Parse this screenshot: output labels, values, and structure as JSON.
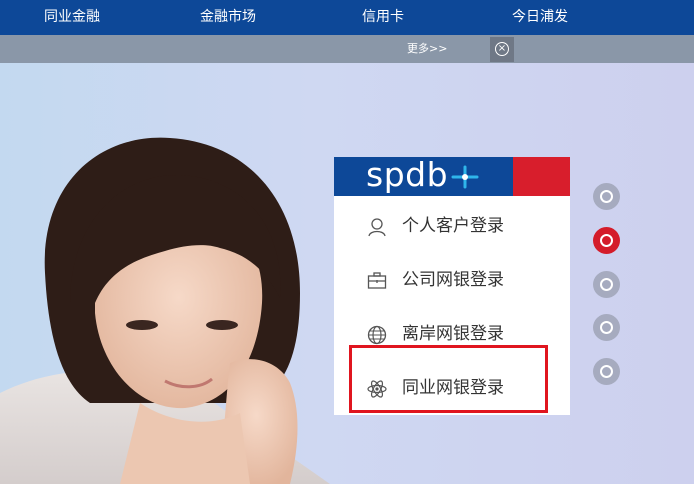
{
  "nav": {
    "items": [
      "同业金融",
      "金融市场",
      "信用卡",
      "今日浦发"
    ]
  },
  "more_bar": {
    "more_label": "更多>>",
    "close_icon": "close-circle-icon"
  },
  "login_panel": {
    "logo_text": "spdb",
    "colors": {
      "brand_blue": "#0d4898",
      "brand_red": "#d81e2c",
      "highlight": "#e0151f"
    },
    "items": [
      {
        "label": "个人客户登录",
        "icon": "person-icon"
      },
      {
        "label": "公司网银登录",
        "icon": "briefcase-icon"
      },
      {
        "label": "离岸网银登录",
        "icon": "globe-icon"
      },
      {
        "label": "同业网银登录",
        "icon": "atom-icon"
      }
    ],
    "highlighted_item": "同业网银登录"
  },
  "carousel": {
    "dot_count": 5,
    "active_index": 1
  }
}
